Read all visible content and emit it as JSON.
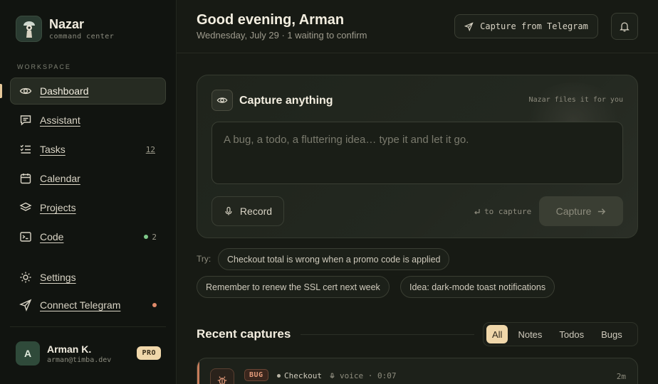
{
  "brand": {
    "name": "Nazar",
    "subtitle": "command center"
  },
  "sidebar": {
    "section_label": "WORKSPACE",
    "items": [
      {
        "label": "Dashboard",
        "icon": "eye-icon"
      },
      {
        "label": "Assistant",
        "icon": "chat-icon"
      },
      {
        "label": "Tasks",
        "icon": "list-icon",
        "count": "12"
      },
      {
        "label": "Calendar",
        "icon": "calendar-icon"
      },
      {
        "label": "Projects",
        "icon": "layers-icon"
      },
      {
        "label": "Code",
        "icon": "terminal-icon",
        "count": "2",
        "status_color": "#7fc98a"
      }
    ],
    "secondary": [
      {
        "label": "Settings",
        "icon": "sun-gear-icon"
      },
      {
        "label": "Connect Telegram",
        "icon": "send-icon",
        "status_color": "#e08a6a"
      }
    ],
    "user": {
      "initial": "A",
      "name": "Arman K.",
      "email": "arman@timba.dev",
      "badge": "PRO"
    }
  },
  "header": {
    "greeting": "Good evening, Arman",
    "date_line": "Wednesday, July 29 · 1 waiting to confirm",
    "telegram_button": "Capture from Telegram"
  },
  "capture": {
    "title": "Capture anything",
    "hint": "Nazar files it for you",
    "placeholder": "A bug, a todo, a fluttering idea… type it and let it go.",
    "record_label": "Record",
    "shortcut_hint": "to capture",
    "capture_label": "Capture"
  },
  "suggestions": {
    "label": "Try:",
    "chips": [
      "Checkout total is wrong when a promo code is applied",
      "Remember to renew the SSL cert next week",
      "Idea: dark-mode toast notifications"
    ]
  },
  "recent": {
    "title": "Recent captures",
    "filters": [
      "All",
      "Notes",
      "Todos",
      "Bugs"
    ],
    "active_filter": "All",
    "items": [
      {
        "type": "BUG",
        "project": "Checkout",
        "source": "voice · 0:07",
        "time": "2m"
      }
    ]
  },
  "colors": {
    "accent": "#f0d7aa",
    "bug": "#c77c5a",
    "background": "#171a14",
    "sidebar": "#111410"
  }
}
